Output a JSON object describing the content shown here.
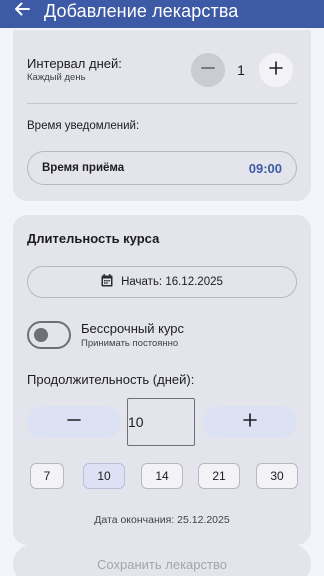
{
  "colors": {
    "primary": "#3d5aa6",
    "surface": "#e4e5ec",
    "background": "#f4f5fb",
    "tonal": "#dde1f4"
  },
  "app_bar": {
    "title": "Добавление лекарства",
    "back_icon": "arrow-left-icon"
  },
  "interval": {
    "label": "Интервал дней:",
    "sublabel": "Каждый день",
    "value": "1",
    "minus_icon": "minus-icon",
    "plus_icon": "plus-icon"
  },
  "notifications": {
    "label": "Время уведомлений:",
    "time_label": "Время приёма",
    "time_value": "09:00"
  },
  "course": {
    "title": "Длительность курса",
    "start_label": "Начать: 16.12.2025",
    "start_icon": "calendar-icon",
    "forever_label": "Бессрочный курс",
    "forever_sub": "Принимать постоянно",
    "forever_enabled": false,
    "duration_label": "Продолжительность (дней):",
    "duration_value": "10",
    "chips": [
      "7",
      "10",
      "14",
      "21",
      "30"
    ],
    "selected_chip": "10",
    "end_date": "Дата окончания: 25.12.2025"
  },
  "save_button": {
    "label": "Сохранить лекарство",
    "enabled": false
  }
}
